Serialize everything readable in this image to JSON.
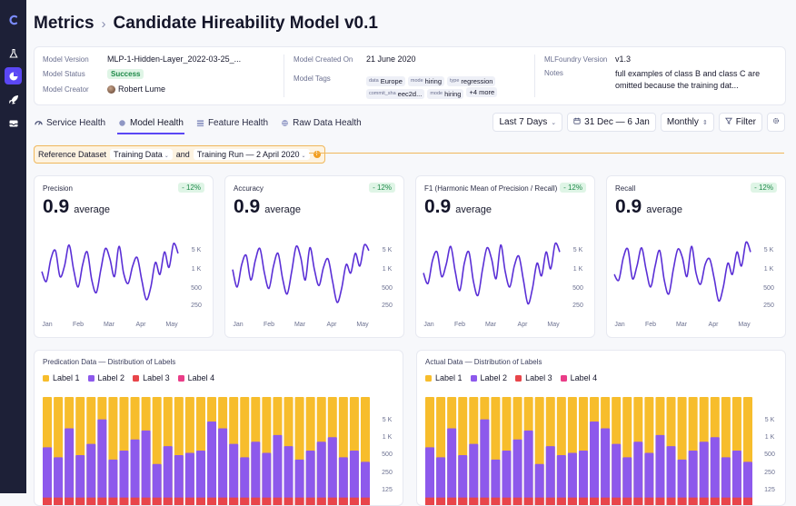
{
  "header": {
    "title": "Metrics",
    "subtitle": "Candidate Hireability Model v0.1"
  },
  "sidebar": {
    "icons": [
      "logo-icon",
      "flask-icon",
      "pie-chart-icon",
      "rocket-icon",
      "inbox-icon"
    ],
    "active": 2
  },
  "meta": {
    "version_label": "Model Version",
    "version_value": "MLP-1-Hidden-Layer_2022-03-25_...",
    "status_label": "Model Status",
    "status_value": "Success",
    "creator_label": "Model Creator",
    "creator_value": "Robert Lume",
    "created_label": "Model Created On",
    "created_value": "21 June 2020",
    "tags_label": "Model Tags",
    "tags_row1": [
      {
        "k": "data",
        "v": "Europe"
      },
      {
        "k": "mode",
        "v": "hiring"
      },
      {
        "k": "type",
        "v": "regression"
      }
    ],
    "tags_row2": [
      {
        "k": "commit_sha",
        "v": "eec2d..."
      },
      {
        "k": "mode",
        "v": "hiring"
      },
      {
        "k": "",
        "v": "+4 more"
      }
    ],
    "mlf_label": "MLFoundry Version",
    "mlf_value": "v1.3",
    "notes_label": "Notes",
    "notes_line1": "full examples of class B and class C are",
    "notes_line2": "omitted because the training dat..."
  },
  "tabs": [
    "Service Health",
    "Model Health",
    "Feature Health",
    "Raw Data Health"
  ],
  "active_tab": 1,
  "controls": {
    "range": "Last 7 Days",
    "dates": "31 Dec — 6 Jan",
    "interval": "Monthly",
    "filter": "Filter"
  },
  "reference": {
    "label": "Reference Dataset",
    "dataset": "Training Data",
    "and": "and",
    "run": "Training Run — 2 April 2020"
  },
  "colors": {
    "accent": "#5b47f5",
    "line": "#5a2fd6",
    "label1": "#f7bd2c",
    "label2": "#8d59ec",
    "label3": "#e8454a",
    "label4": "#ea3d88"
  },
  "metric_cards": [
    {
      "title": "Precision",
      "delta": "- 12%",
      "value": "0.9",
      "unit": "average"
    },
    {
      "title": "Accuracy",
      "delta": "- 12%",
      "value": "0.9",
      "unit": "average"
    },
    {
      "title": "F1 (Harmonic Mean of Precision / Recall)",
      "delta": "- 12%",
      "value": "0.9",
      "unit": "average"
    },
    {
      "title": "Recall",
      "delta": "- 12%",
      "value": "0.9",
      "unit": "average"
    }
  ],
  "chart_data": [
    {
      "type": "line",
      "title": "Precision",
      "x_ticks": [
        "Jan",
        "Feb",
        "Mar",
        "Apr",
        "May"
      ],
      "y_ticks": [
        "5 K",
        "1 K",
        "500",
        "250"
      ],
      "values": [
        0.52,
        0.38,
        0.7,
        0.82,
        0.45,
        0.6,
        0.9,
        0.55,
        0.3,
        0.62,
        0.8,
        0.4,
        0.22,
        0.55,
        0.85,
        0.7,
        0.45,
        0.88,
        0.5,
        0.35,
        0.6,
        0.72,
        0.4,
        0.12,
        0.3,
        0.65,
        0.48,
        0.8,
        0.58,
        0.92,
        0.78
      ]
    },
    {
      "type": "line",
      "title": "Accuracy",
      "x_ticks": [
        "Jan",
        "Feb",
        "Mar",
        "Apr",
        "May"
      ],
      "y_ticks": [
        "5 K",
        "1 K",
        "500",
        "250"
      ],
      "values": [
        0.55,
        0.3,
        0.62,
        0.75,
        0.4,
        0.68,
        0.85,
        0.5,
        0.28,
        0.6,
        0.78,
        0.42,
        0.2,
        0.52,
        0.88,
        0.72,
        0.4,
        0.86,
        0.55,
        0.32,
        0.58,
        0.7,
        0.38,
        0.08,
        0.28,
        0.62,
        0.5,
        0.78,
        0.6,
        0.9,
        0.82
      ]
    },
    {
      "type": "line",
      "title": "F1 (Harmonic Mean of Precision / Recall)",
      "x_ticks": [
        "Jan",
        "Feb",
        "Mar",
        "Apr",
        "May"
      ],
      "y_ticks": [
        "5 K",
        "1 K",
        "500",
        "250"
      ],
      "values": [
        0.5,
        0.35,
        0.68,
        0.8,
        0.45,
        0.62,
        0.88,
        0.52,
        0.25,
        0.64,
        0.8,
        0.38,
        0.18,
        0.55,
        0.86,
        0.7,
        0.42,
        0.9,
        0.52,
        0.3,
        0.6,
        0.74,
        0.4,
        0.06,
        0.28,
        0.64,
        0.46,
        0.8,
        0.56,
        0.92,
        0.8
      ]
    },
    {
      "type": "line",
      "title": "Recall",
      "x_ticks": [
        "Jan",
        "Feb",
        "Mar",
        "Apr",
        "May"
      ],
      "y_ticks": [
        "5 K",
        "1 K",
        "500",
        "250"
      ],
      "values": [
        0.48,
        0.4,
        0.72,
        0.84,
        0.42,
        0.6,
        0.86,
        0.55,
        0.3,
        0.6,
        0.82,
        0.4,
        0.2,
        0.55,
        0.84,
        0.72,
        0.45,
        0.88,
        0.5,
        0.34,
        0.62,
        0.7,
        0.42,
        0.1,
        0.3,
        0.64,
        0.48,
        0.8,
        0.6,
        0.94,
        0.8
      ]
    },
    {
      "type": "bar",
      "title": "Predication Data — Distribution of Labels",
      "legend": [
        "Label 1",
        "Label 2",
        "Label 3",
        "Label 4"
      ],
      "y_ticks": [
        "5 K",
        "1 K",
        "500",
        "250",
        "125"
      ],
      "totals": [
        1,
        1,
        1,
        1,
        1,
        1,
        1,
        1,
        1,
        1,
        1,
        1,
        1,
        1,
        1,
        1,
        1,
        1,
        1,
        1,
        1,
        1,
        1,
        1,
        1,
        1,
        1,
        1,
        1,
        1
      ],
      "label2": [
        0.55,
        0.46,
        0.72,
        0.48,
        0.58,
        0.8,
        0.44,
        0.52,
        0.62,
        0.7,
        0.4,
        0.56,
        0.48,
        0.5,
        0.52,
        0.78,
        0.72,
        0.58,
        0.46,
        0.6,
        0.5,
        0.66,
        0.56,
        0.44,
        0.52,
        0.6,
        0.64,
        0.46,
        0.52,
        0.42
      ],
      "label3": [
        0.1,
        0.1,
        0.1,
        0.1,
        0.1,
        0.1,
        0.1,
        0.1,
        0.1,
        0.1,
        0.1,
        0.1,
        0.1,
        0.1,
        0.1,
        0.1,
        0.1,
        0.1,
        0.1,
        0.1,
        0.1,
        0.1,
        0.1,
        0.1,
        0.1,
        0.1,
        0.1,
        0.1,
        0.1,
        0.1
      ]
    },
    {
      "type": "bar",
      "title": "Actual Data — Distribution of Labels",
      "legend": [
        "Label 1",
        "Label 2",
        "Label 3",
        "Label 4"
      ],
      "y_ticks": [
        "5 K",
        "1 K",
        "500",
        "250",
        "125"
      ],
      "totals": [
        1,
        1,
        1,
        1,
        1,
        1,
        1,
        1,
        1,
        1,
        1,
        1,
        1,
        1,
        1,
        1,
        1,
        1,
        1,
        1,
        1,
        1,
        1,
        1,
        1,
        1,
        1,
        1,
        1,
        1
      ],
      "label2": [
        0.55,
        0.46,
        0.72,
        0.48,
        0.58,
        0.8,
        0.44,
        0.52,
        0.62,
        0.7,
        0.4,
        0.56,
        0.48,
        0.5,
        0.52,
        0.78,
        0.72,
        0.58,
        0.46,
        0.6,
        0.5,
        0.66,
        0.56,
        0.44,
        0.52,
        0.6,
        0.64,
        0.46,
        0.52,
        0.42
      ],
      "label3": [
        0.1,
        0.1,
        0.1,
        0.1,
        0.1,
        0.1,
        0.1,
        0.1,
        0.1,
        0.1,
        0.1,
        0.1,
        0.1,
        0.1,
        0.1,
        0.1,
        0.1,
        0.1,
        0.1,
        0.1,
        0.1,
        0.1,
        0.1,
        0.1,
        0.1,
        0.1,
        0.1,
        0.1,
        0.1,
        0.1
      ]
    }
  ]
}
